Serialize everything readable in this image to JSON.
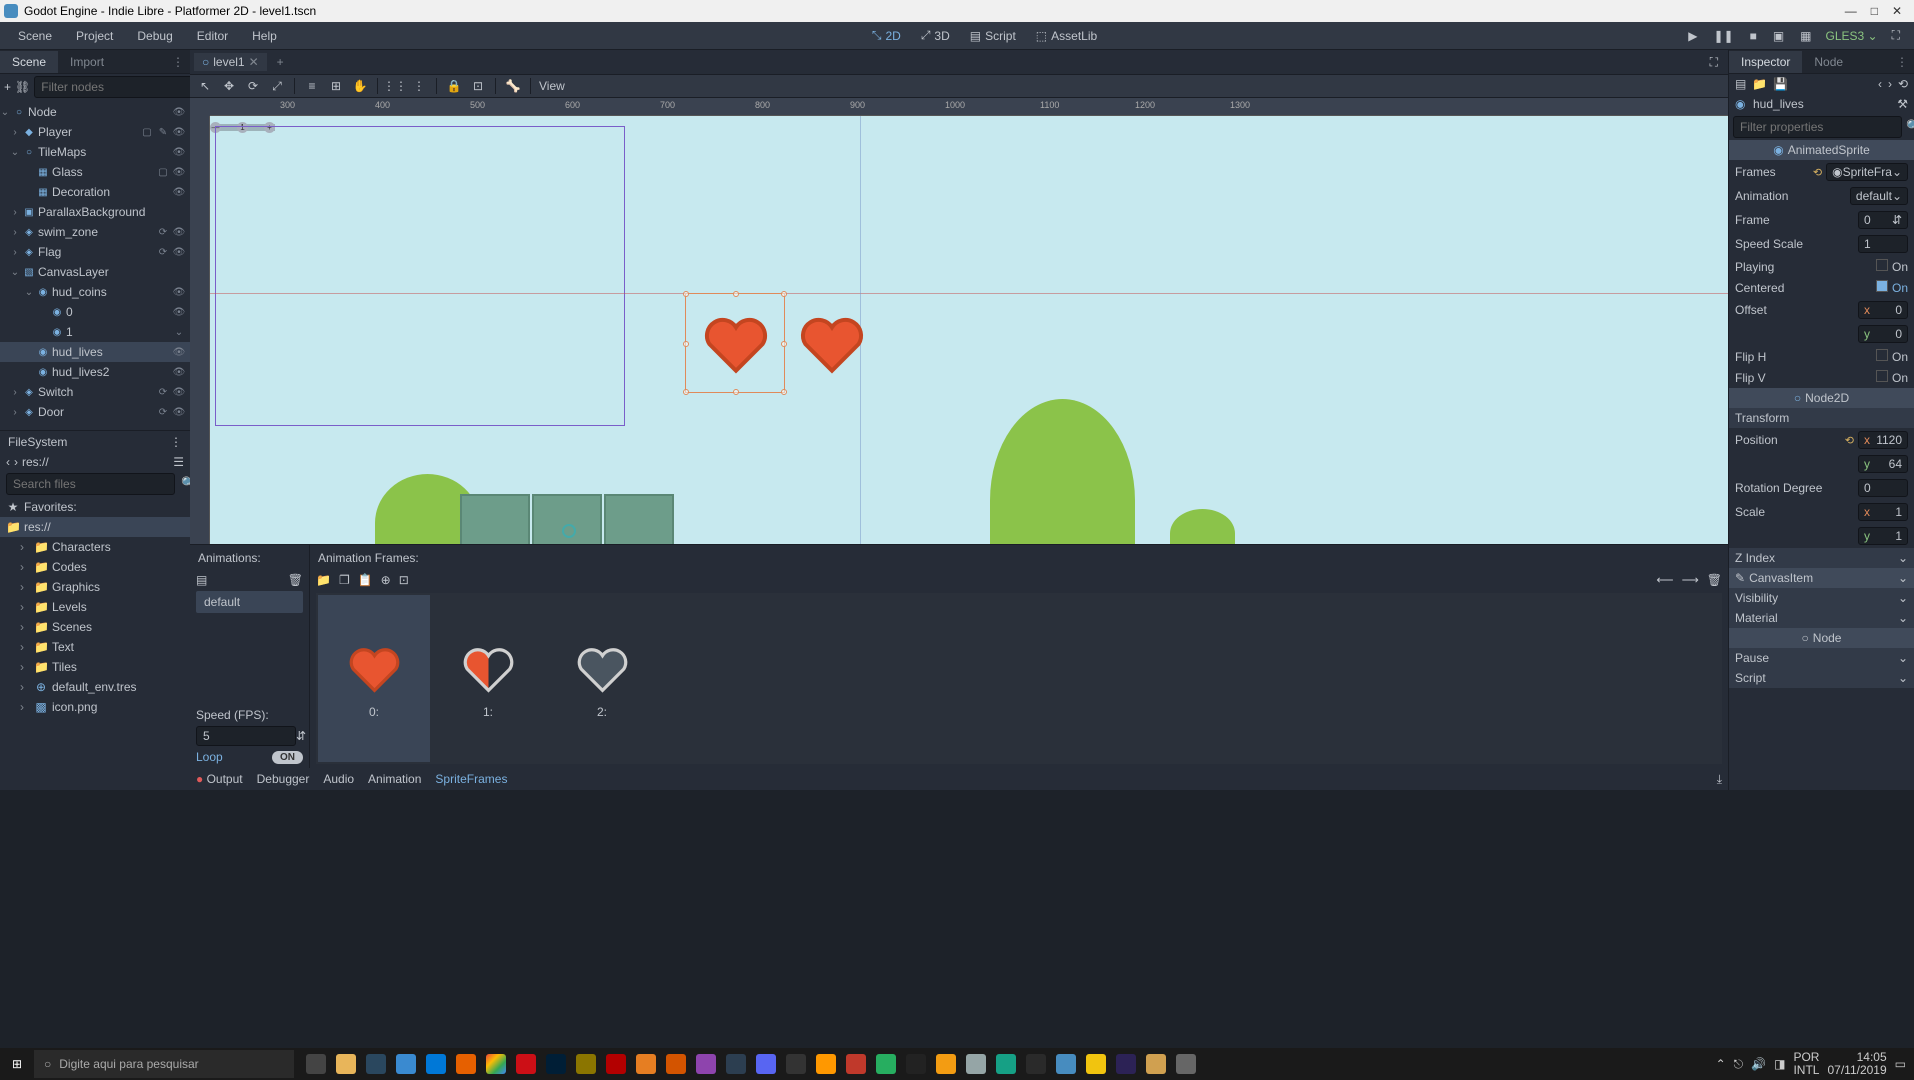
{
  "window": {
    "title": "Godot Engine - Indie Libre - Platformer 2D - level1.tscn"
  },
  "menubar": {
    "items": [
      "Scene",
      "Project",
      "Debug",
      "Editor",
      "Help"
    ],
    "modes": {
      "m2d": "2D",
      "m3d": "3D",
      "script": "Script",
      "assetlib": "AssetLib"
    },
    "renderer": "GLES3"
  },
  "scene_dock": {
    "tabs": {
      "scene": "Scene",
      "import": "Import"
    },
    "filter_placeholder": "Filter nodes",
    "tree": [
      {
        "label": "Node",
        "indent": 0,
        "icon": "○",
        "toggle": "⌄",
        "icons": [
          "👁"
        ]
      },
      {
        "label": "Player",
        "indent": 1,
        "icon": "◆",
        "toggle": "›",
        "icons": [
          "▢",
          "✎",
          "👁"
        ]
      },
      {
        "label": "TileMaps",
        "indent": 1,
        "icon": "○",
        "toggle": "⌄",
        "icons": [
          "👁"
        ]
      },
      {
        "label": "Glass",
        "indent": 2,
        "icon": "▦",
        "toggle": "",
        "icons": [
          "▢",
          "👁"
        ]
      },
      {
        "label": "Decoration",
        "indent": 2,
        "icon": "▦",
        "toggle": "",
        "icons": [
          "👁"
        ]
      },
      {
        "label": "ParallaxBackground",
        "indent": 1,
        "icon": "▣",
        "toggle": "›",
        "icons": []
      },
      {
        "label": "swim_zone",
        "indent": 1,
        "icon": "◈",
        "toggle": "›",
        "icons": [
          "⟳",
          "👁"
        ]
      },
      {
        "label": "Flag",
        "indent": 1,
        "icon": "◈",
        "toggle": "›",
        "icons": [
          "⟳",
          "👁"
        ]
      },
      {
        "label": "CanvasLayer",
        "indent": 1,
        "icon": "▧",
        "toggle": "⌄",
        "icons": []
      },
      {
        "label": "hud_coins",
        "indent": 2,
        "icon": "◉",
        "toggle": "⌄",
        "icons": [
          "👁"
        ]
      },
      {
        "label": "0",
        "indent": 3,
        "icon": "◉",
        "toggle": "",
        "icons": [
          "👁"
        ]
      },
      {
        "label": "1",
        "indent": 3,
        "icon": "◉",
        "toggle": "",
        "icons": [
          "⌄"
        ]
      },
      {
        "label": "hud_lives",
        "indent": 2,
        "icon": "◉",
        "toggle": "",
        "icons": [
          "👁"
        ],
        "selected": true
      },
      {
        "label": "hud_lives2",
        "indent": 2,
        "icon": "◉",
        "toggle": "",
        "icons": [
          "👁"
        ]
      },
      {
        "label": "Switch",
        "indent": 1,
        "icon": "◈",
        "toggle": "›",
        "icons": [
          "⟳",
          "👁"
        ]
      },
      {
        "label": "Door",
        "indent": 1,
        "icon": "◈",
        "toggle": "›",
        "icons": [
          "⟳",
          "👁"
        ]
      }
    ]
  },
  "filesystem": {
    "title": "FileSystem",
    "path": "res://",
    "search_placeholder": "Search files",
    "favorites": "Favorites:",
    "tree": [
      {
        "label": "res://",
        "icon": "📁",
        "indent": 0,
        "selected": true
      },
      {
        "label": "Characters",
        "icon": "📁",
        "indent": 1
      },
      {
        "label": "Codes",
        "icon": "📁",
        "indent": 1
      },
      {
        "label": "Graphics",
        "icon": "📁",
        "indent": 1
      },
      {
        "label": "Levels",
        "icon": "📁",
        "indent": 1
      },
      {
        "label": "Scenes",
        "icon": "📁",
        "indent": 1
      },
      {
        "label": "Text",
        "icon": "📁",
        "indent": 1
      },
      {
        "label": "Tiles",
        "icon": "📁",
        "indent": 1
      },
      {
        "label": "default_env.tres",
        "icon": "⊕",
        "indent": 1
      },
      {
        "label": "icon.png",
        "icon": "▩",
        "indent": 1
      }
    ]
  },
  "viewport": {
    "scene_tab": "level1",
    "view_menu": "View",
    "ruler_ticks": [
      "300",
      "400",
      "500",
      "600",
      "700",
      "800",
      "900",
      "1000",
      "1100",
      "1200",
      "1300"
    ]
  },
  "animations": {
    "header_left": "Animations:",
    "header_right": "Animation Frames:",
    "item": "default",
    "speed_label": "Speed (FPS):",
    "speed_value": "5",
    "loop_label": "Loop",
    "loop_value": "ON",
    "frames": [
      "0:",
      "1:",
      "2:"
    ]
  },
  "bottom_tabs": {
    "output": "Output",
    "debugger": "Debugger",
    "audio": "Audio",
    "animation": "Animation",
    "spriteframes": "SpriteFrames"
  },
  "inspector": {
    "tabs": {
      "inspector": "Inspector",
      "node": "Node"
    },
    "node_name": "hud_lives",
    "filter_placeholder": "Filter properties",
    "section_animsprite": "AnimatedSprite",
    "props": {
      "frames": {
        "label": "Frames",
        "value": "SpriteFra"
      },
      "animation": {
        "label": "Animation",
        "value": "default"
      },
      "frame": {
        "label": "Frame",
        "value": "0"
      },
      "speed_scale": {
        "label": "Speed Scale",
        "value": "1"
      },
      "playing": {
        "label": "Playing",
        "value": "On"
      },
      "centered": {
        "label": "Centered",
        "value": "On"
      },
      "offset": {
        "label": "Offset",
        "x": "0",
        "y": "0"
      },
      "flip_h": {
        "label": "Flip H",
        "value": "On"
      },
      "flip_v": {
        "label": "Flip V",
        "value": "On"
      }
    },
    "section_node2d": "Node2D",
    "sub_transform": "Transform",
    "transform": {
      "position": {
        "label": "Position",
        "x": "1120",
        "y": "64"
      },
      "rotation": {
        "label": "Rotation Degree",
        "value": "0"
      },
      "scale": {
        "label": "Scale",
        "x": "1",
        "y": "1"
      }
    },
    "z_index": "Z Index",
    "section_canvasitem": "CanvasItem",
    "visibility": "Visibility",
    "material": "Material",
    "section_node": "Node",
    "pause": "Pause",
    "script": "Script"
  },
  "taskbar": {
    "search_placeholder": "Digite aqui para pesquisar",
    "lang": "POR",
    "kbd": "INTL",
    "time": "14:05",
    "date": "07/11/2019"
  }
}
